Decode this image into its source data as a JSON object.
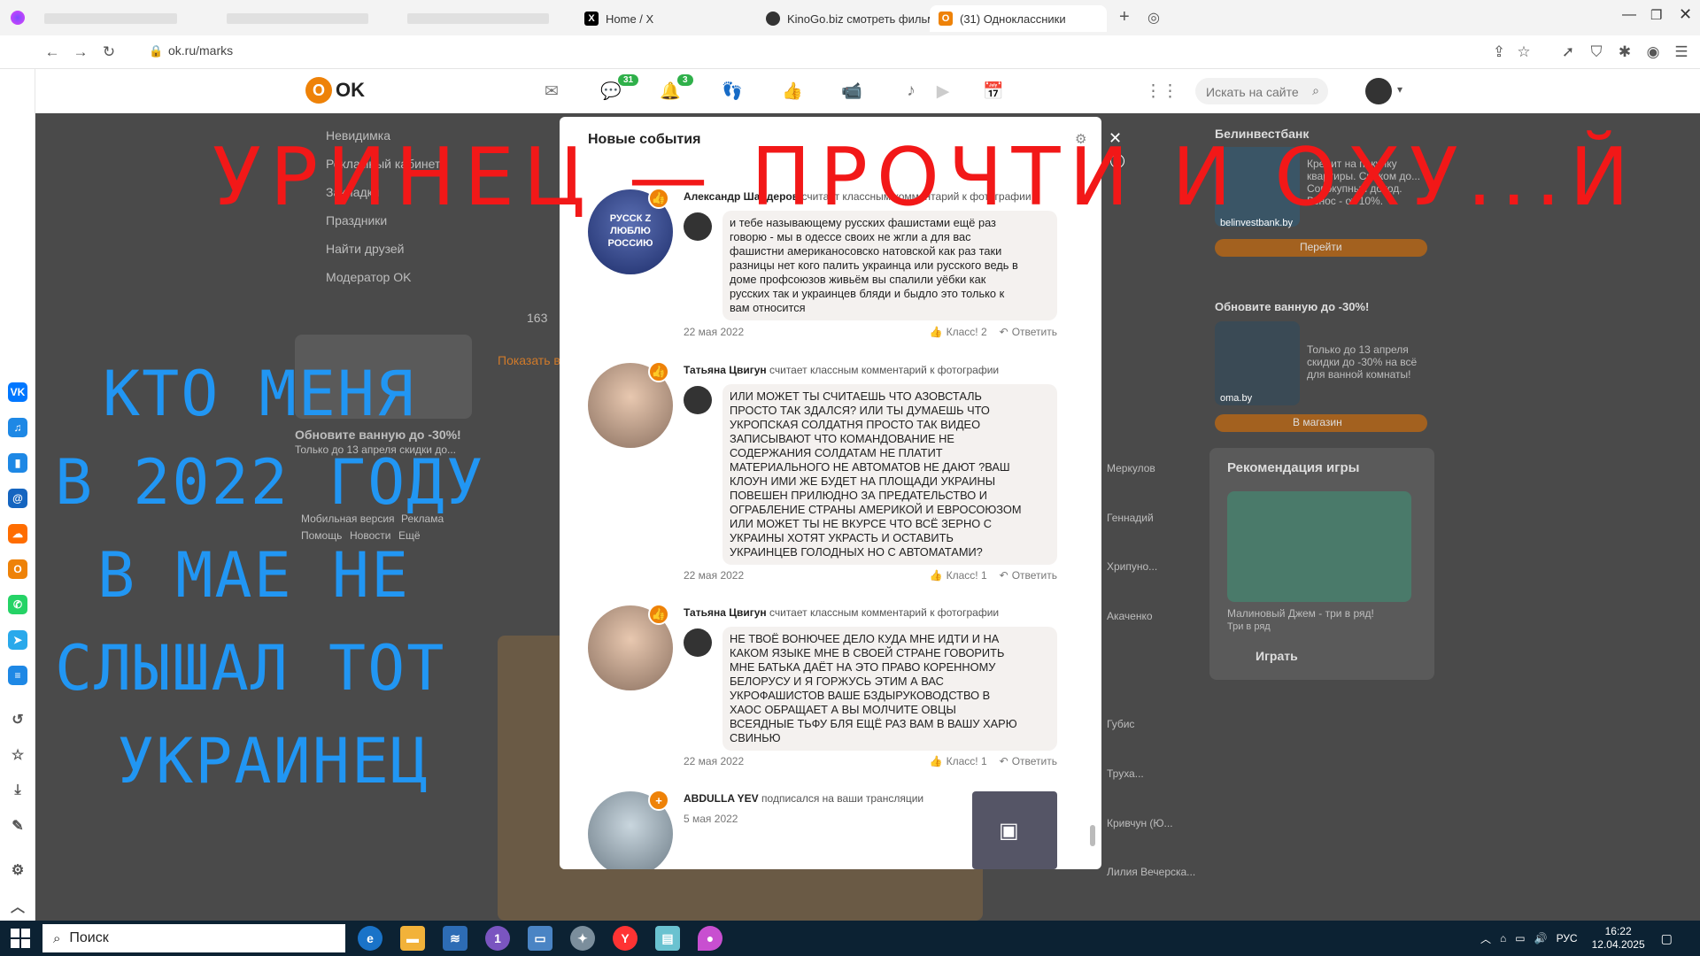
{
  "browser": {
    "tabs": [
      {
        "label": "Home / X",
        "icon": "x-icon"
      },
      {
        "label": "KinoGo.biz смотреть фильм",
        "icon": "kinogo-icon"
      },
      {
        "label": "(31) Одноклассники",
        "icon": "ok-icon"
      }
    ],
    "url": "ok.ru/marks"
  },
  "ok_header": {
    "logo": "OK",
    "badge_messages": "31",
    "badge_notifications": "3",
    "search_placeholder": "Искать на сайте"
  },
  "left_menu": {
    "items": [
      "Невидимка",
      "Рекламный кабинет",
      "Закладки",
      "Праздники",
      "Найти друзей",
      "Модератор OK"
    ],
    "promo_title": "Обновите ванную до -30%!",
    "promo_text": "Только до 13 апреля скидки до...",
    "footer_links": [
      "Мобильная версия",
      "Реклама",
      "Помощь",
      "Новости",
      "Ещё"
    ],
    "count": "163",
    "show_more": "Показать в..."
  },
  "right_column": {
    "bank_title": "Белинвестбанк",
    "bank_text": "Кредит на покупку квартиры. Сроком до... Совокупный доход. Взнос - от 10%.",
    "bank_site": "belinvestbank.by",
    "bank_button": "Перейти",
    "promo2_title": "Обновите ванную до -30%!",
    "promo2_text": "Только до 13 апреля скидки до -30% на всё для ванной комнаты!",
    "promo2_site": "oma.by",
    "promo2_button": "В магазин",
    "game_section": "Рекомендация игры",
    "game_name": "Малиновый Джем - три в ряд!",
    "game_sub": "Три в ряд",
    "game_button": "Играть",
    "friends": [
      "Меркулов",
      "Геннадий",
      "Хрипуно...",
      "Акаченко",
      "Губис",
      "Труха...",
      "Кривчун (Ю...",
      "Лилия Вечерска..."
    ]
  },
  "modal": {
    "title": "Новые события",
    "events": [
      {
        "author": "Александр Шайдеров",
        "action": "считает классным комментарий",
        "target": "к фотографии",
        "text": "и тебе называющему русских фашистами ещё раз\nговорю - мы в одессе своих не жгли а для вас\nфашистни американосовско натовской как раз таки\nразницы нет кого палить украинца или русского ведь в\nдоме профсоюзов живьём вы спалили уёбки как\nрусских так и украинцев бляди и быдло это только к\nвам относится",
        "date": "22 мая 2022",
        "likes": "Класс! 2",
        "reply": "Ответить",
        "avatar_label": "РУССК Z ЛЮБЛЮ РОССИЮ"
      },
      {
        "author": "Татьяна Цвигун",
        "action": "считает классным комментарий",
        "target": "к фотографии",
        "text": "ИЛИ МОЖЕТ ТЫ СЧИТАЕШЬ ЧТО АЗОВСТАЛЬ\nПРОСТО ТАК ЗДАЛСЯ? ИЛИ ТЫ ДУМАЕШЬ ЧТО\nУКРОПСКАЯ СОЛДАТНЯ ПРОСТО ТАК ВИДЕО\nЗАПИСЫВАЮТ ЧТО КОМАНДОВАНИЕ НЕ\nСОДЕРЖАНИЯ СОЛДАТАМ НЕ ПЛАТИТ\nМАТЕРИАЛЬНОГО НЕ АВТОМАТОВ НЕ ДАЮТ ?ВАШ\nКЛОУН ИМИ ЖЕ БУДЕТ НА ПЛОЩАДИ УКРАИНЫ\nПОВЕШЕН ПРИЛЮДНО ЗА ПРЕДАТЕЛЬСТВО И\nОГРАБЛЕНИЕ СТРАНЫ АМЕРИКОЙ И ЕВРОСОЮЗОМ\nИЛИ МОЖЕТ ТЫ НЕ ВКУРСЕ ЧТО ВСЁ ЗЕРНО С\nУКРАИНЫ ХОТЯТ УКРАСТЬ И ОСТАВИТЬ\nУКРАИНЦЕВ ГОЛОДНЫХ НО С АВТОМАТАМИ?",
        "date": "22 мая 2022",
        "likes": "Класс! 1",
        "reply": "Ответить"
      },
      {
        "author": "Татьяна Цвигун",
        "action": "считает классным комментарий",
        "target": "к фотографии",
        "text": "НЕ ТВОЁ ВОНЮЧЕЕ ДЕЛО КУДА МНЕ ИДТИ И НА\nКАКОМ ЯЗЫКЕ МНЕ В СВОЕЙ СТРАНЕ ГОВОРИТЬ\nМНЕ БАТЬКА ДАЁТ НА ЭТО ПРАВО КОРЕННОМУ\nБЕЛОРУСУ И Я ГОРЖУСЬ ЭТИМ А ВАС\nУКРОФАШИСТОВ ВАШЕ БЗДЫРУКОВОДСТВО В\nХАОС ОБРАЩАЕТ А ВЫ МОЛЧИТЕ ОВЦЫ\nВСЕЯДНЫЕ ТЬФУ БЛЯ ЕЩЁ РАЗ ВАМ В ВАШУ ХАРЮ\nСВИНЬЮ",
        "date": "22 мая 2022",
        "likes": "Класс! 1",
        "reply": "Ответить"
      },
      {
        "author": "ABDULLA YEV",
        "action": "подписался на ваши трансляции",
        "target": "",
        "date": "5 мая 2022"
      }
    ]
  },
  "overlay": {
    "red_line": "УРИНЕЦ — ПРОЧТИ И ОХУ...Й",
    "blue_lines": [
      "КТО МЕНЯ",
      "В 2022 ГОДУ",
      "В МАЕ НЕ",
      "СЛЫШАЛ ТОТ",
      "УКРАИНЕЦ"
    ]
  },
  "taskbar": {
    "search": "Поиск",
    "lang": "РУС",
    "time": "16:22",
    "date": "12.04.2025"
  }
}
